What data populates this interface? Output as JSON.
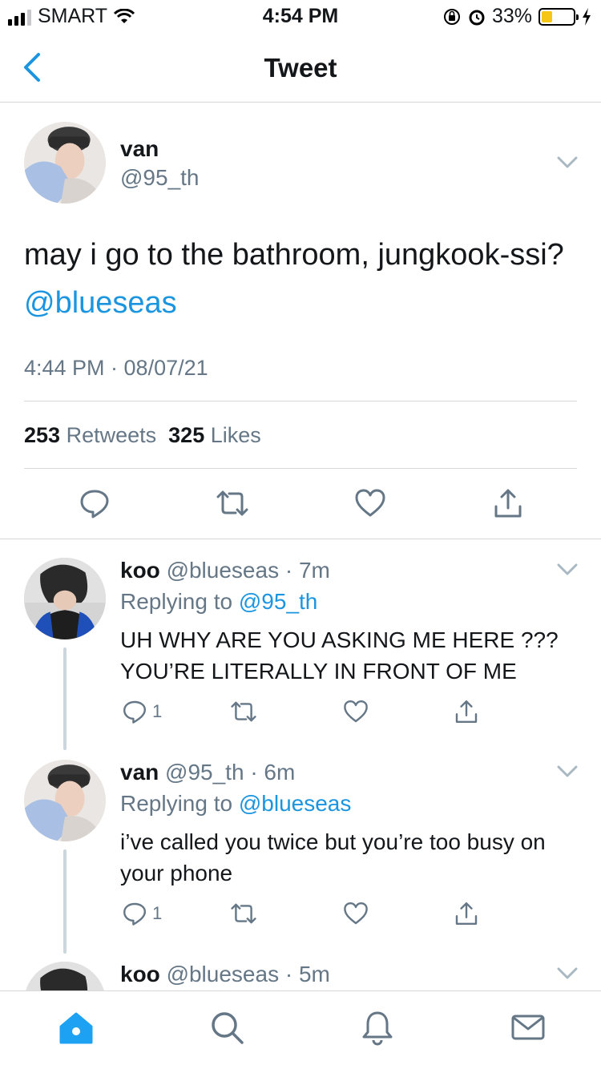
{
  "status_bar": {
    "carrier": "SMART",
    "time": "4:54 PM",
    "battery": "33%"
  },
  "nav": {
    "title": "Tweet"
  },
  "main_tweet": {
    "name": "van",
    "handle": "@95_th",
    "text": "may i go to the bathroom, jungkook-ssi? ",
    "mention": "@blueseas",
    "timestamp": "4:44 PM · 08/07/21",
    "retweets_count": "253",
    "retweets_label": "Retweets",
    "likes_count": "325",
    "likes_label": "Likes"
  },
  "replies": [
    {
      "name": "koo",
      "handle": "@blueseas",
      "time": "· 7m",
      "replying_label": "Replying to",
      "replying_to": "@95_th",
      "text": "UH WHY ARE YOU ASKING ME HERE ??? YOU’RE LITERALLY IN FRONT OF ME",
      "reply_count": "1"
    },
    {
      "name": "van",
      "handle": "@95_th",
      "time": "· 6m",
      "replying_label": "Replying to",
      "replying_to": "@blueseas",
      "text": "i’ve called you twice but you’re too busy on your phone",
      "reply_count": "1"
    },
    {
      "name": "koo",
      "handle": "@blueseas",
      "time": "· 5m"
    }
  ],
  "colors": {
    "accent": "#1b95e0",
    "muted": "#657786",
    "text": "#14171a",
    "battery": "#f5c518"
  },
  "icons": [
    "back-icon",
    "chevron-down-icon",
    "reply-icon",
    "retweet-icon",
    "like-icon",
    "share-icon",
    "home-icon",
    "search-icon",
    "notifications-icon",
    "messages-icon"
  ]
}
